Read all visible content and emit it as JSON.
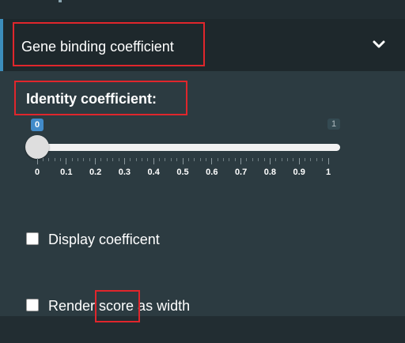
{
  "section": {
    "title": "Gene binding coefficient",
    "expand_icon": "chevron-down-icon",
    "accent_color": "#3c8dbc"
  },
  "slider": {
    "label": "Identity coefficient:",
    "min": 0,
    "max": 1,
    "value": 0,
    "value_label": "0",
    "max_label": "1",
    "ticks": [
      "0",
      "0.1",
      "0.2",
      "0.3",
      "0.4",
      "0.5",
      "0.6",
      "0.7",
      "0.8",
      "0.9",
      "1"
    ],
    "bubble_color": "#428bca"
  },
  "checkboxes": [
    {
      "label": "Display coefficent",
      "checked": false
    },
    {
      "label": "Render score as width",
      "checked": false
    }
  ],
  "annotation_color": "#e0262c"
}
